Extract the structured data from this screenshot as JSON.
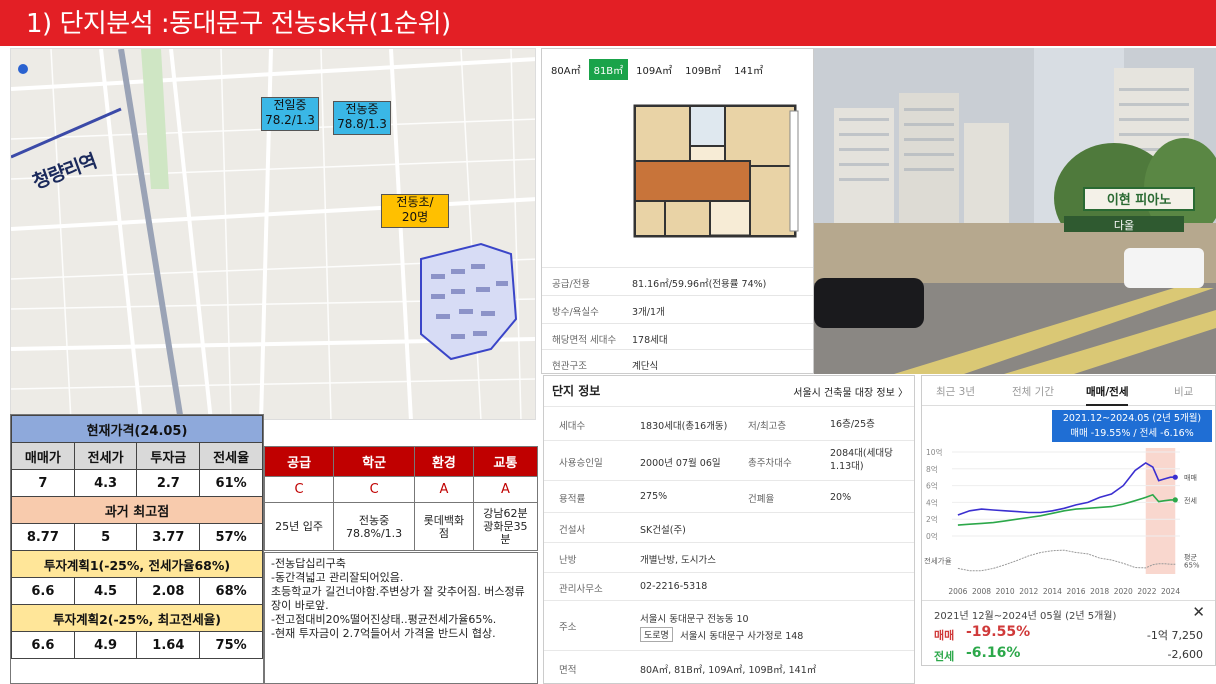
{
  "header": {
    "title": "1) 단지분석 :동대문구 전농sk뷰(1순위)"
  },
  "map": {
    "station_label": "청량리역",
    "badges": [
      {
        "label": "전일중\n78.2/1.3"
      },
      {
        "label": "전농중\n78.8/1.3"
      },
      {
        "label": "전동초/\n20명"
      }
    ]
  },
  "price_table": {
    "current_title": "현재가격(24.05)",
    "headers": [
      "매매가",
      "전세가",
      "투자금",
      "전세율"
    ],
    "current_values": [
      "7",
      "4.3",
      "2.7",
      "61%"
    ],
    "past_title": "과거 최고점",
    "past_values": [
      "8.77",
      "5",
      "3.77",
      "57%"
    ],
    "plan1_title": "투자계획1(-25%, 전세가율68%)",
    "plan1_values": [
      "6.6",
      "4.5",
      "2.08",
      "68%"
    ],
    "plan2_title": "투자계획2(-25%, 최고전세율)",
    "plan2_values": [
      "6.6",
      "4.9",
      "1.64",
      "75%"
    ]
  },
  "grade_table": {
    "headers": [
      "공급",
      "학군",
      "환경",
      "교통"
    ],
    "grades": [
      "C",
      "C",
      "A",
      "A"
    ],
    "descs": [
      "25년 입주",
      "전농중\n78.8%/1.3",
      "롯데백화\n점",
      "강남62분\n광화문35\n분"
    ]
  },
  "notes": [
    "-전농답십리구축",
    "-동간격넓고  관리잘되어있음.",
    "  초등학교가  길건너야함.주변상가  잘  갖추어짐. 버스정류장이 바로앞.",
    "-전고점대비20%떨어진상태..평균전세가율65%.",
    "-현재  투자금이  2.7억들어서  가격을 반드시 협상."
  ],
  "floorplan": {
    "tabs": [
      "80A㎡",
      "81B㎡",
      "109A㎡",
      "109B㎡",
      "141㎡"
    ],
    "active_tab": 1,
    "rows": [
      {
        "k": "공급/전용",
        "v": "81.16㎡/59.96㎡(전용률 74%)"
      },
      {
        "k": "방수/욕실수",
        "v": "3개/1개"
      },
      {
        "k": "해당면적 세대수",
        "v": "178세대"
      },
      {
        "k": "현관구조",
        "v": "계단식"
      }
    ]
  },
  "photo": {
    "sign_text": "이현 피아노",
    "sign2_text": "다올"
  },
  "complex_info": {
    "title": "단지 정보",
    "link": "서울시 건축물 대장 정보 〉",
    "rows": [
      {
        "k": "세대수",
        "v": "1830세대(총16개동)",
        "k2": "저/최고층",
        "v2": "16층/25층"
      },
      {
        "k": "사용승인일",
        "v": "2000년 07월 06일",
        "k2": "총주차대수",
        "v2": "2084대(세대당 1.13대)"
      },
      {
        "k": "용적률",
        "v": "275%",
        "k2": "건폐율",
        "v2": "20%"
      },
      {
        "k": "건설사",
        "v": "SK건설(주)"
      },
      {
        "k": "난방",
        "v": "개별난방, 도시가스"
      },
      {
        "k": "관리사무소",
        "v": "02-2216-5318"
      },
      {
        "k": "주소",
        "v": "서울시 동대문구 전농동 10",
        "road_tag": "도로명",
        "road": "서울시 동대문구 사가정로 148"
      },
      {
        "k": "면적",
        "v": "80A㎡, 81B㎡, 109A㎡, 109B㎡, 141㎡"
      }
    ]
  },
  "chart_card": {
    "tabs": [
      "최근 3년",
      "전체 기간",
      "매매/전세",
      "비교"
    ],
    "active_tab": 2,
    "tooltip_line1": "2021.12~2024.05 (2년 5개월)",
    "tooltip_line2": "매매 -19.55%  /  전세 -6.16%",
    "period_text": "2021년 12월~2024년 05월 (2년 5개월)",
    "close_icon": "✕",
    "sale_label": "매매",
    "sale_pct": "-19.55%",
    "sale_amt": "-1억 7,250",
    "rent_label": "전세",
    "rent_pct": "-6.16%",
    "rent_amt": "-2,600",
    "colors": {
      "sale": "#3b2fd0",
      "rent": "#2ca84a",
      "ratio": "#999999",
      "highlight": "#f4b6a6",
      "tooltip": "#1f6ed4"
    }
  },
  "chart_data": {
    "type": "line",
    "x": [
      2006,
      2007,
      2008,
      2009,
      2010,
      2011,
      2012,
      2013,
      2014,
      2015,
      2016,
      2017,
      2018,
      2019,
      2020,
      2021,
      2021.9,
      2022.5,
      2023,
      2023.5,
      2024,
      2024.4
    ],
    "series": [
      {
        "name": "매매",
        "values": [
          2.5,
          3.0,
          3.2,
          3.1,
          3.0,
          2.9,
          2.8,
          2.8,
          3.0,
          3.3,
          3.7,
          4.0,
          4.6,
          5.0,
          6.0,
          7.8,
          8.7,
          8.2,
          6.6,
          6.8,
          7.0,
          7.0
        ]
      },
      {
        "name": "전세",
        "values": [
          1.3,
          1.4,
          1.5,
          1.6,
          1.8,
          2.0,
          2.2,
          2.4,
          2.7,
          3.0,
          3.2,
          3.3,
          3.4,
          3.5,
          3.8,
          4.2,
          4.6,
          4.9,
          4.1,
          4.2,
          4.3,
          4.3
        ]
      },
      {
        "name": "전세가율",
        "values": [
          52,
          47,
          47,
          52,
          60,
          69,
          79,
          86,
          90,
          91,
          86,
          83,
          74,
          70,
          63,
          54,
          53,
          60,
          62,
          62,
          61,
          61
        ]
      }
    ],
    "y_ticks": [
      "10억",
      "8억",
      "6억",
      "4억",
      "2억",
      "0억"
    ],
    "x_ticks": [
      "2006",
      "2008",
      "2010",
      "2012",
      "2014",
      "2016",
      "2018",
      "2020",
      "2022",
      "2024"
    ],
    "ratio_axis_label": "전세가율",
    "end_labels": [
      "매매",
      "전세",
      "평균\n65%"
    ],
    "ylim": [
      0,
      10
    ],
    "highlight_range": [
      2021.9,
      2024.4
    ]
  }
}
